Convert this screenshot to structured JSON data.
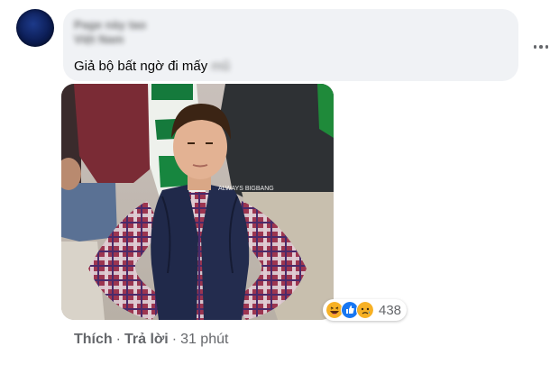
{
  "comment": {
    "author_line1": "Page này tao",
    "author_line2": "Việt Nam",
    "text": "Giả bộ bất ngờ đi mấy",
    "text_blurred": "mũ",
    "image_watermark": "ALWAYS BIGBANG",
    "reactions": {
      "icons": [
        "haha-icon",
        "like-icon",
        "sad-icon"
      ],
      "count": "438"
    },
    "actions": {
      "like_label": "Thích",
      "separator": "·",
      "reply_label": "Trả lời",
      "time": "31 phút"
    }
  },
  "colors": {
    "bubble_bg": "#f0f2f5",
    "meta_text": "#65676b",
    "main_text": "#050505",
    "like_blue": "#1877f2",
    "reaction_yellow": "#f7b125"
  }
}
